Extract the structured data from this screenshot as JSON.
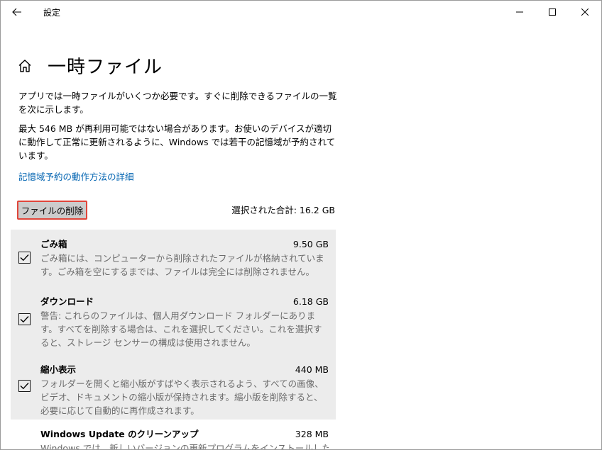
{
  "window": {
    "title": "設定"
  },
  "header": {
    "title": "一時ファイル"
  },
  "intro": {
    "p1": "アプリでは一時ファイルがいくつか必要です。すぐに削除できるファイルの一覧を次に示します。",
    "p2": "最大 546 MB が再利用可能ではない場合があります。お使いのデバイスが適切に動作して正常に更新されるように、Windows では若干の記憶域が予約されています。",
    "link": "記憶域予約の動作方法の詳細"
  },
  "actions": {
    "delete_label": "ファイルの削除",
    "total_label": "選択された合計: 16.2 GB"
  },
  "items": [
    {
      "title": "ごみ箱",
      "size": "9.50 GB",
      "checked": true,
      "description": "ごみ箱には、コンピューターから削除されたファイルが格納されています。ごみ箱を空にするまでは、ファイルは完全には削除されません。"
    },
    {
      "title": "ダウンロード",
      "size": "6.18 GB",
      "checked": true,
      "description": "警告: これらのファイルは、個人用ダウンロード フォルダーにあります。すべてを削除する場合は、これを選択してください。これを選択すると、ストレージ センサーの構成は使用されません。"
    },
    {
      "title": "縮小表示",
      "size": "440 MB",
      "checked": true,
      "description": "フォルダーを開くと縮小版がすばやく表示されるよう、すべての画像、ビデオ、ドキュメントの縮小版が保持されます。縮小版を削除すると、必要に応じて自動的に再作成されます。"
    },
    {
      "title": "Windows Update のクリーンアップ",
      "size": "328 MB",
      "checked": false,
      "description": "Windows では、新しいバージョンの更新プログラムをインストールした後で"
    }
  ],
  "icons": {
    "back": "back-arrow-icon",
    "home": "home-icon",
    "minimize": "minimize-icon",
    "maximize": "maximize-icon",
    "close": "close-icon",
    "check": "checkmark-icon"
  },
  "colors": {
    "link": "#0063b1",
    "highlight_border": "#e0453a",
    "selected_bg": "#ececec",
    "description": "#6b6b6b"
  }
}
